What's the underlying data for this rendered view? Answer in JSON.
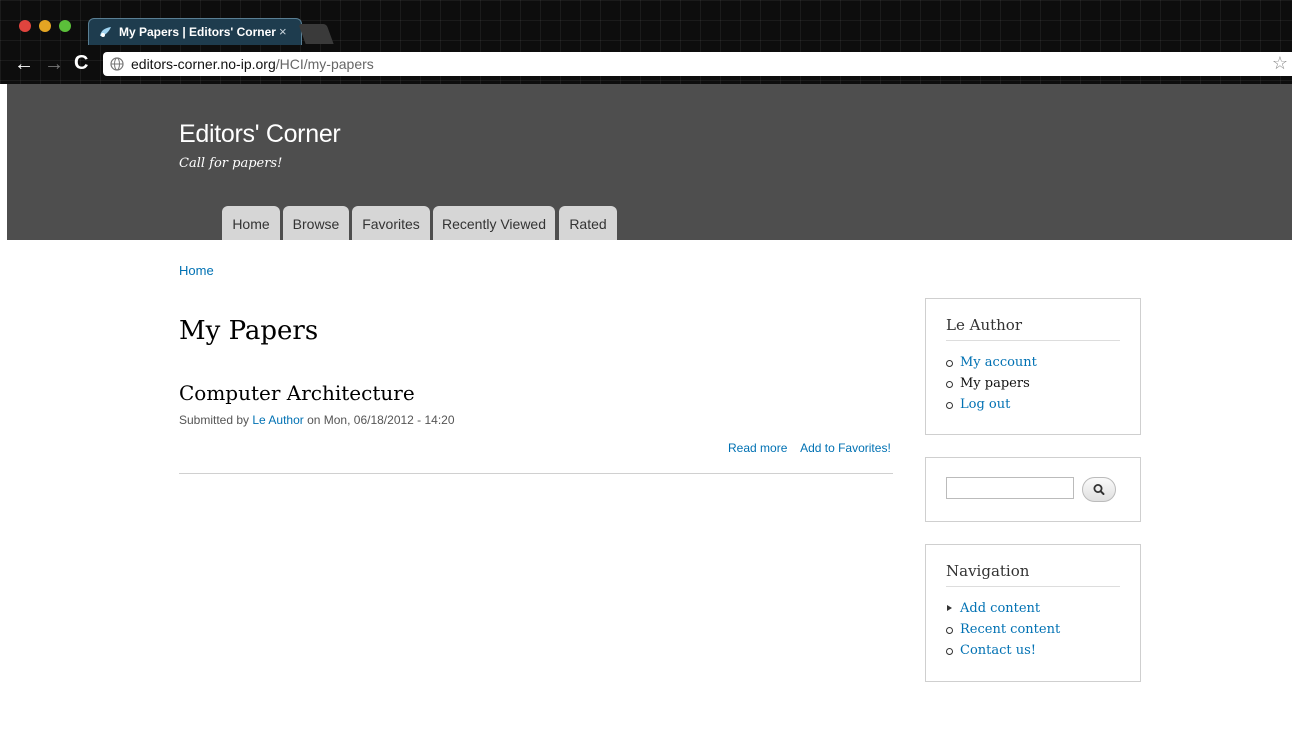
{
  "browser": {
    "tab_title": "My Papers | Editors' Corner",
    "tab_close": "×",
    "back": "←",
    "forward": "→",
    "reload": "C",
    "url_host": "editors-corner.no-ip.org",
    "url_path": "/HCI/my-papers",
    "star": "☆"
  },
  "site": {
    "name": "Editors' Corner",
    "slogan": "Call for papers!"
  },
  "primary_tabs": [
    "Home",
    "Browse",
    "Favorites",
    "Recently Viewed",
    "Rated"
  ],
  "breadcrumb": "Home",
  "page_title": "My Papers",
  "node": {
    "title": "Computer Architecture",
    "submitted_prefix": "Submitted by ",
    "author": "Le Author",
    "submitted_suffix": " on Mon, 06/18/2012 - 14:20",
    "read_more": "Read more",
    "add_favorites": "Add to Favorites!"
  },
  "user_block": {
    "title": "Le Author",
    "items": [
      "My account",
      "My papers",
      "Log out"
    ]
  },
  "navigation_block": {
    "title": "Navigation",
    "items": [
      "Add content",
      "Recent content",
      "Contact us!"
    ]
  },
  "colors": {
    "link": "#0071b3",
    "header_bg": "#4e4e4e",
    "tab_bg": "#d6d6d6"
  }
}
